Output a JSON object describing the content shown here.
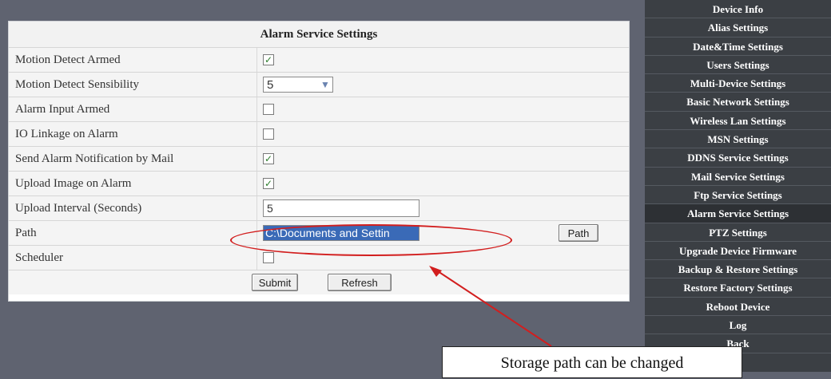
{
  "panel": {
    "title": "Alarm Service Settings",
    "rows": [
      {
        "label": "Motion Detect Armed",
        "type": "checkbox",
        "checked": true
      },
      {
        "label": "Motion Detect Sensibility",
        "type": "select",
        "value": "5"
      },
      {
        "label": "Alarm Input Armed",
        "type": "checkbox",
        "checked": false
      },
      {
        "label": "IO Linkage on Alarm",
        "type": "checkbox",
        "checked": false
      },
      {
        "label": "Send Alarm Notification by Mail",
        "type": "checkbox",
        "checked": true
      },
      {
        "label": "Upload Image on Alarm",
        "type": "checkbox",
        "checked": true
      },
      {
        "label": "Upload Interval (Seconds)",
        "type": "text",
        "value": "5"
      },
      {
        "label": "Path",
        "type": "path",
        "value": "C:\\Documents and Settin",
        "button": "Path"
      },
      {
        "label": "Scheduler",
        "type": "checkbox",
        "checked": false
      }
    ],
    "submit_label": "Submit",
    "refresh_label": "Refresh"
  },
  "sidebar": {
    "active": "Alarm Service Settings",
    "items": [
      "Device Info",
      "Alias Settings",
      "Date&Time Settings",
      "Users Settings",
      "Multi-Device Settings",
      "Basic Network Settings",
      "Wireless Lan Settings",
      "MSN Settings",
      "DDNS Service Settings",
      "Mail Service Settings",
      "Ftp Service Settings",
      "Alarm Service Settings",
      "PTZ Settings",
      "Upgrade Device Firmware",
      "Backup & Restore Settings",
      "Restore Factory Settings",
      "Reboot Device",
      "Log",
      "Back"
    ]
  },
  "annotation": {
    "callout_text": "Storage path can be changed",
    "color": "#d21e1e"
  },
  "icons": {
    "checkmark": "checkmark-icon",
    "dropdown": "chevron-down-icon"
  }
}
